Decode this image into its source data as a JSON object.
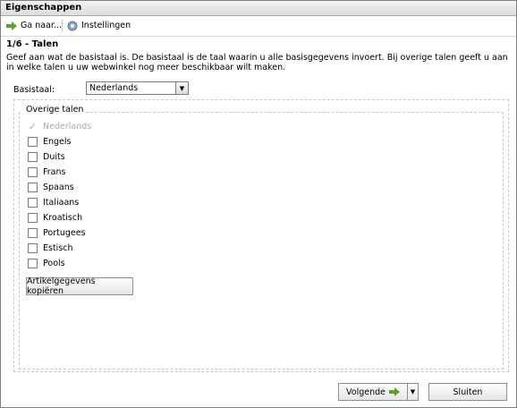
{
  "window": {
    "title": "Eigenschappen"
  },
  "toolbar": {
    "goto_label": "Ga naar...",
    "settings_label": "Instellingen"
  },
  "step": {
    "title": "1/6 - Talen",
    "description": "Geef aan wat de basistaal is. De basistaal is de taal waarin u alle basisgegevens invoert. Bij overige talen geeft u aan in welke talen u uw webwinkel nog meer beschikbaar wilt maken."
  },
  "base_language": {
    "label": "Basistaal:",
    "value": "Nederlands"
  },
  "other_languages": {
    "caption": "Overige talen",
    "items": [
      {
        "label": "Nederlands",
        "checked": true,
        "disabled": true
      },
      {
        "label": "Engels",
        "checked": false
      },
      {
        "label": "Duits",
        "checked": false
      },
      {
        "label": "Frans",
        "checked": false
      },
      {
        "label": "Spaans",
        "checked": false
      },
      {
        "label": "Italiaans",
        "checked": false
      },
      {
        "label": "Kroatisch",
        "checked": false
      },
      {
        "label": "Portugees",
        "checked": false
      },
      {
        "label": "Estisch",
        "checked": false
      },
      {
        "label": "Pools",
        "checked": false
      }
    ]
  },
  "copy_button": {
    "label": "Artikelgegevens kopiëren"
  },
  "footer": {
    "next_label": "Volgende",
    "close_label": "Sluiten"
  },
  "colors": {
    "arrow_green": "#5aa02c",
    "disabled_text": "#a9a9a9"
  }
}
